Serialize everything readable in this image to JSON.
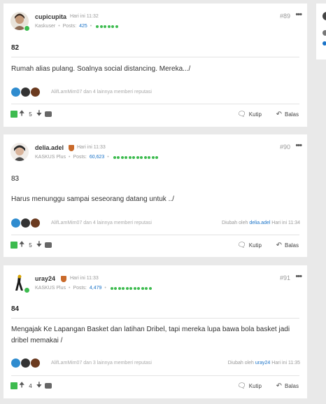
{
  "posts": [
    {
      "username": "cupicupita",
      "time": "Hari ini 11:32",
      "rank": "Kaskuser",
      "posts_label": "Posts:",
      "posts_count": "425",
      "post_number": "#89",
      "more": "•••",
      "number_line": "82",
      "text": "Rumah alias pulang. Soalnya social distancing. Mereka.../",
      "reputation_text": "AlifLamMim07 dan 4 lainnya memberi reputasi",
      "vote_count": "5",
      "quote_label": "Kutip",
      "reply_label": "Balas"
    },
    {
      "username": "delia.adel",
      "time": "Hari ini 11:33",
      "rank": "KASKUS Plus",
      "posts_label": "Posts:",
      "posts_count": "60,623",
      "post_number": "#90",
      "more": "•••",
      "number_line": "83",
      "text": "Harus menunggu sampai seseorang datang untuk ../",
      "reputation_text": "AlifLamMim07 dan 4 lainnya memberi reputasi",
      "edit_prefix": "Diubah oleh",
      "edit_user": "delia.adel",
      "edit_time": "Hari ini 11:34",
      "vote_count": "5",
      "quote_label": "Kutip",
      "reply_label": "Balas"
    },
    {
      "username": "uray24",
      "time": "Hari ini 11:33",
      "rank": "KASKUS Plus",
      "posts_label": "Posts:",
      "posts_count": "4,479",
      "post_number": "#91",
      "more": "•••",
      "number_line": "84",
      "text": "Mengajak Ke Lapangan Basket dan latihan Dribel, tapi mereka lupa bawa bola basket jadi dribel memakai /",
      "reputation_text": "AlifLamMim07 dan 3 lainnya memberi reputasi",
      "edit_prefix": "Diubah oleh",
      "edit_user": "uray24",
      "edit_time": "Hari ini 11:35",
      "vote_count": "4",
      "quote_label": "Kutip",
      "reply_label": "Balas"
    }
  ],
  "icons": {
    "vote": "cendol-icon",
    "upvote": "arrow-up-icon",
    "downvote": "arrow-down-icon",
    "share": "share-icon",
    "quote": "quote-icon",
    "reply": "reply-icon"
  },
  "colors": {
    "accent_green": "#3dbb4f",
    "link_blue": "#1a73c8",
    "badge_orange": "#c96a2b"
  }
}
